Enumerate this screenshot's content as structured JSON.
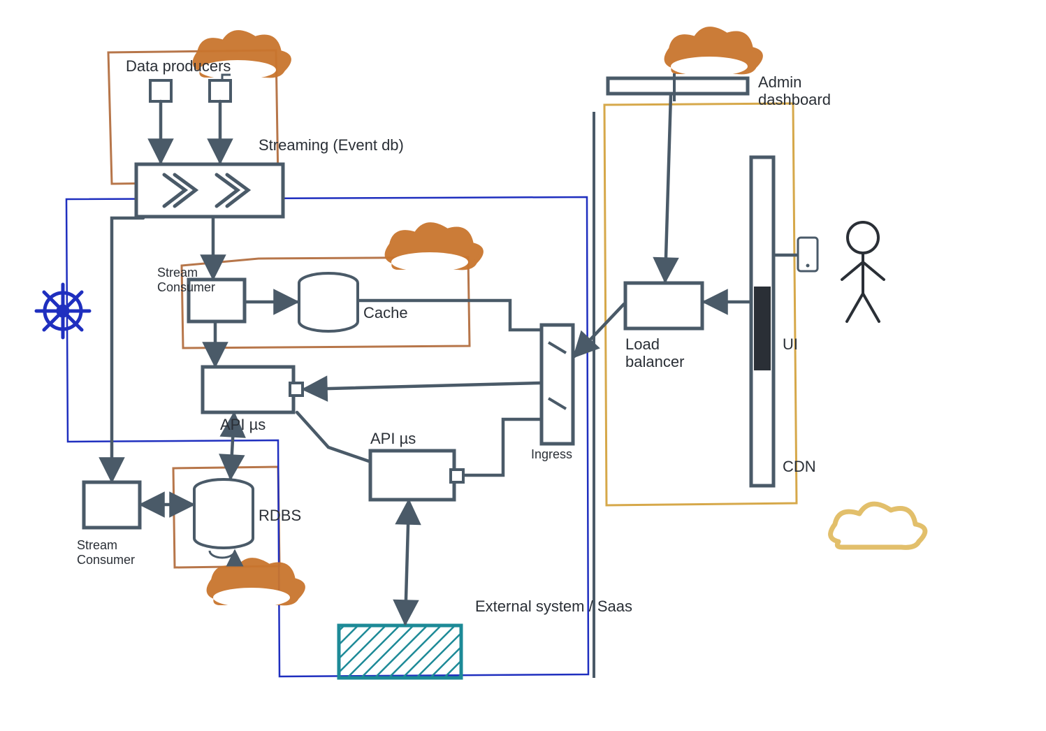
{
  "labels": {
    "data_producers": "Data producers",
    "streaming": "Streaming (Event db)",
    "stream_consumer_top": "Stream\nConsumer",
    "cache": "Cache",
    "api_ms_1": "API µs",
    "api_ms_2": "API µs",
    "rdbs": "RDBS",
    "stream_consumer_bottom": "Stream\nConsumer",
    "ingress": "Ingress",
    "load_balancer": "Load\nbalancer",
    "admin_dashboard": "Admin\ndashboard",
    "ui": "UI",
    "cdn": "CDN",
    "external_system": "External system / Saas"
  },
  "colors": {
    "ink": "#4a5a68",
    "blue_group": "#1f2fbf",
    "brown_group": "#b7764a",
    "yellow_group": "#d6a84a",
    "cloud": "#c9752e",
    "yellow_cloud": "#e2bf6b",
    "teal": "#1d8a97"
  },
  "diagram": {
    "type": "architecture",
    "nodes": [
      {
        "id": "producer1",
        "kind": "box-small",
        "label_ref": "data_producers"
      },
      {
        "id": "producer2",
        "kind": "box-small"
      },
      {
        "id": "streaming",
        "kind": "stream-bus",
        "label_ref": "streaming"
      },
      {
        "id": "stream_consumer_a",
        "kind": "box",
        "label_ref": "stream_consumer_top"
      },
      {
        "id": "stream_consumer_b",
        "kind": "box",
        "label_ref": "stream_consumer_bottom"
      },
      {
        "id": "cache",
        "kind": "cylinder",
        "label_ref": "cache"
      },
      {
        "id": "api_ms_1",
        "kind": "box",
        "label_ref": "api_ms_1"
      },
      {
        "id": "api_ms_2",
        "kind": "box",
        "label_ref": "api_ms_2"
      },
      {
        "id": "rdbs",
        "kind": "cylinder",
        "label_ref": "rdbs"
      },
      {
        "id": "ingress",
        "kind": "vertical-bar",
        "label_ref": "ingress"
      },
      {
        "id": "load_balancer",
        "kind": "box",
        "label_ref": "load_balancer"
      },
      {
        "id": "admin_dashboard",
        "kind": "slim-box",
        "label_ref": "admin_dashboard"
      },
      {
        "id": "ui_cdn",
        "kind": "tall-bar",
        "labels": [
          "ui",
          "cdn"
        ]
      },
      {
        "id": "user",
        "kind": "stick-figure"
      },
      {
        "id": "mobile",
        "kind": "mobile-device"
      },
      {
        "id": "external_system",
        "kind": "hatched-box",
        "label_ref": "external_system"
      },
      {
        "id": "k8s_wheel",
        "kind": "helm-wheel"
      }
    ],
    "edges": [
      {
        "from": "producer1",
        "to": "streaming"
      },
      {
        "from": "producer2",
        "to": "streaming"
      },
      {
        "from": "streaming",
        "to": "stream_consumer_a"
      },
      {
        "from": "streaming",
        "to": "stream_consumer_b"
      },
      {
        "from": "stream_consumer_a",
        "to": "cache"
      },
      {
        "from": "stream_consumer_a",
        "to": "api_ms_1"
      },
      {
        "from": "stream_consumer_b",
        "to": "rdbs",
        "bidir": true
      },
      {
        "from": "api_ms_1",
        "to": "rdbs",
        "bidir": true
      },
      {
        "from": "api_ms_1",
        "to": "api_ms_2"
      },
      {
        "from": "cache",
        "to": "ingress"
      },
      {
        "from": "api_ms_1",
        "to": "ingress"
      },
      {
        "from": "api_ms_2",
        "to": "ingress"
      },
      {
        "from": "load_balancer",
        "to": "ingress"
      },
      {
        "from": "ui_cdn",
        "to": "load_balancer"
      },
      {
        "from": "user",
        "to": "ui_cdn"
      },
      {
        "from": "mobile",
        "to": "ui_cdn"
      },
      {
        "from": "admin_dashboard",
        "to": "load_balancer"
      },
      {
        "from": "api_ms_2",
        "to": "external_system",
        "bidir": true
      }
    ],
    "groups": [
      {
        "color_ref": "brown_group",
        "contains": [
          "producer1",
          "producer2",
          "streaming"
        ]
      },
      {
        "color_ref": "brown_group",
        "contains": [
          "stream_consumer_a",
          "cache"
        ]
      },
      {
        "color_ref": "brown_group",
        "contains": [
          "rdbs"
        ]
      },
      {
        "color_ref": "yellow_group",
        "contains": [
          "admin_dashboard",
          "load_balancer",
          "ui_cdn"
        ]
      },
      {
        "color_ref": "blue_group",
        "kind": "kubernetes",
        "contains": [
          "streaming",
          "stream_consumer_a",
          "stream_consumer_b",
          "api_ms_1",
          "api_ms_2",
          "ingress"
        ]
      }
    ],
    "clouds": [
      {
        "near": "producers",
        "color_ref": "cloud"
      },
      {
        "near": "cache-group",
        "color_ref": "cloud"
      },
      {
        "near": "rdbs-group",
        "color_ref": "cloud"
      },
      {
        "near": "admin_dashboard",
        "color_ref": "cloud"
      },
      {
        "near": "cdn",
        "color_ref": "yellow_cloud"
      }
    ]
  }
}
